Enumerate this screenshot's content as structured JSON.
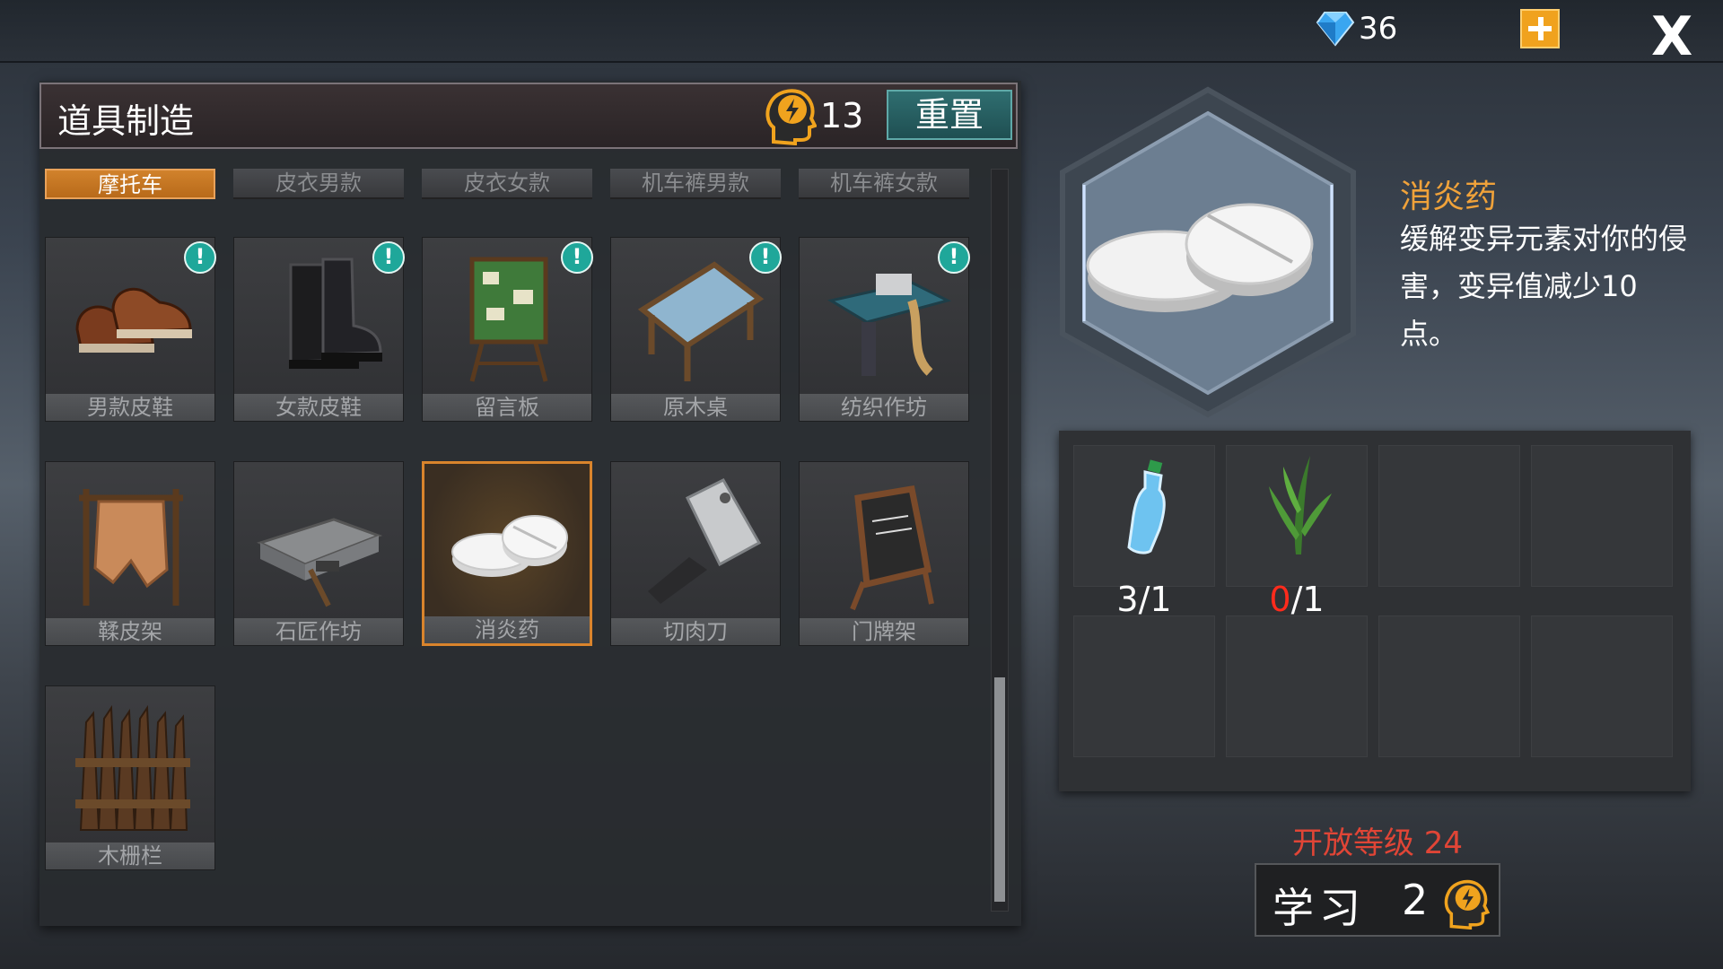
{
  "top_bar": {
    "gems": "36",
    "close_label": "X"
  },
  "panel": {
    "title": "道具制造",
    "points": "13",
    "reset_label": "重置"
  },
  "tabs": [
    {
      "label": "摩托车",
      "active": true
    },
    {
      "label": "皮衣男款",
      "active": false
    },
    {
      "label": "皮衣女款",
      "active": false
    },
    {
      "label": "机车裤男款",
      "active": false
    },
    {
      "label": "机车裤女款",
      "active": false
    }
  ],
  "items": [
    {
      "label": "男款皮鞋",
      "icon": "leather-shoes-men-icon",
      "new": true
    },
    {
      "label": "女款皮鞋",
      "icon": "leather-boots-women-icon",
      "new": true
    },
    {
      "label": "留言板",
      "icon": "message-board-icon",
      "new": true
    },
    {
      "label": "原木桌",
      "icon": "log-table-icon",
      "new": true
    },
    {
      "label": "纺织作坊",
      "icon": "textile-workshop-icon",
      "new": true
    },
    {
      "label": "鞣皮架",
      "icon": "tanning-rack-icon",
      "new": false
    },
    {
      "label": "石匠作坊",
      "icon": "mason-workshop-icon",
      "new": false
    },
    {
      "label": "消炎药",
      "icon": "pills-icon",
      "new": false,
      "selected": true
    },
    {
      "label": "切肉刀",
      "icon": "cleaver-icon",
      "new": false
    },
    {
      "label": "门牌架",
      "icon": "signboard-icon",
      "new": false
    },
    {
      "label": "木栅栏",
      "icon": "wood-fence-icon",
      "new": false
    }
  ],
  "detail": {
    "name": "消炎药",
    "description": "缓解变异元素对你的侵害，变异值减少10点。",
    "requirements": [
      {
        "icon": "water-bottle-icon",
        "have": "3",
        "need": "1"
      },
      {
        "icon": "herb-icon",
        "have": "0",
        "need": "1"
      }
    ],
    "unlock_text": "开放等级 24",
    "learn_label": "学习",
    "learn_cost": "2"
  },
  "colors": {
    "accent_orange": "#d9842c",
    "badge_teal": "#1fa79a",
    "alert_red": "#e04536"
  }
}
